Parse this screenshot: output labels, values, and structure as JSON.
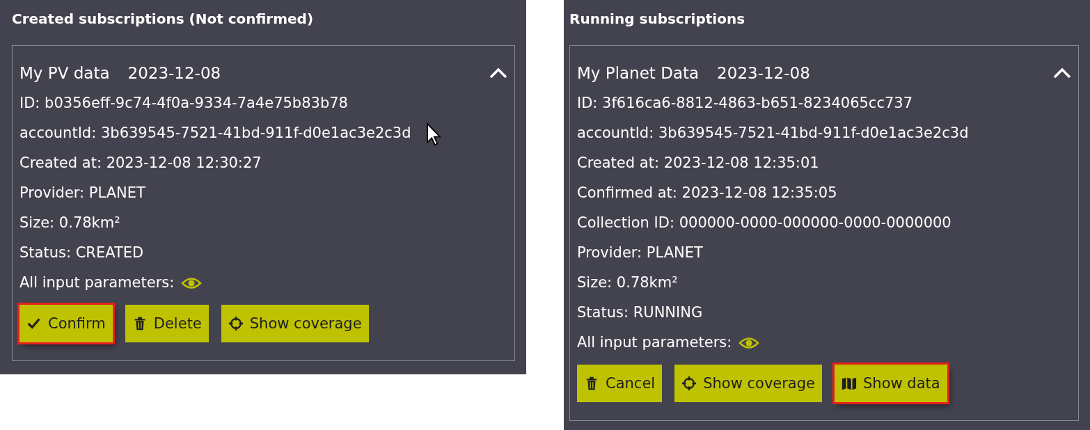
{
  "panels": [
    {
      "title": "Created subscriptions (Not confirmed)",
      "subscription": {
        "name": "My PV data",
        "date": "2023-12-08",
        "expanded": true,
        "details": [
          "ID: b0356eff-9c74-4f0a-9334-7a4e75b83b78",
          "accountId: 3b639545-7521-41bd-911f-d0e1ac3e2c3d",
          "Created at: 2023-12-08 12:30:27",
          "Provider: PLANET",
          "Size: 0.78km²",
          "Status: CREATED"
        ],
        "parameters_label": "All input parameters:",
        "buttons": [
          {
            "label": "Confirm",
            "kind": "check",
            "highlighted": true
          },
          {
            "label": "Delete",
            "kind": "trash",
            "highlighted": false
          },
          {
            "label": "Show coverage",
            "kind": "crosshair",
            "highlighted": false
          }
        ]
      }
    },
    {
      "title": "Running subscriptions",
      "subscription": {
        "name": "My Planet Data",
        "date": "2023-12-08",
        "expanded": true,
        "details": [
          "ID: 3f616ca6-8812-4863-b651-8234065cc737",
          "accountId: 3b639545-7521-41bd-911f-d0e1ac3e2c3d",
          "Created at: 2023-12-08 12:35:01",
          "Confirmed at: 2023-12-08 12:35:05",
          "Collection ID: 000000-0000-000000-0000-0000000",
          "Provider: PLANET",
          "Size: 0.78km²",
          "Status: RUNNING"
        ],
        "parameters_label": "All input parameters:",
        "buttons": [
          {
            "label": "Cancel",
            "kind": "trash",
            "highlighted": false
          },
          {
            "label": "Show coverage",
            "kind": "crosshair",
            "highlighted": false
          },
          {
            "label": "Show data",
            "kind": "map",
            "highlighted": true
          }
        ]
      }
    }
  ]
}
